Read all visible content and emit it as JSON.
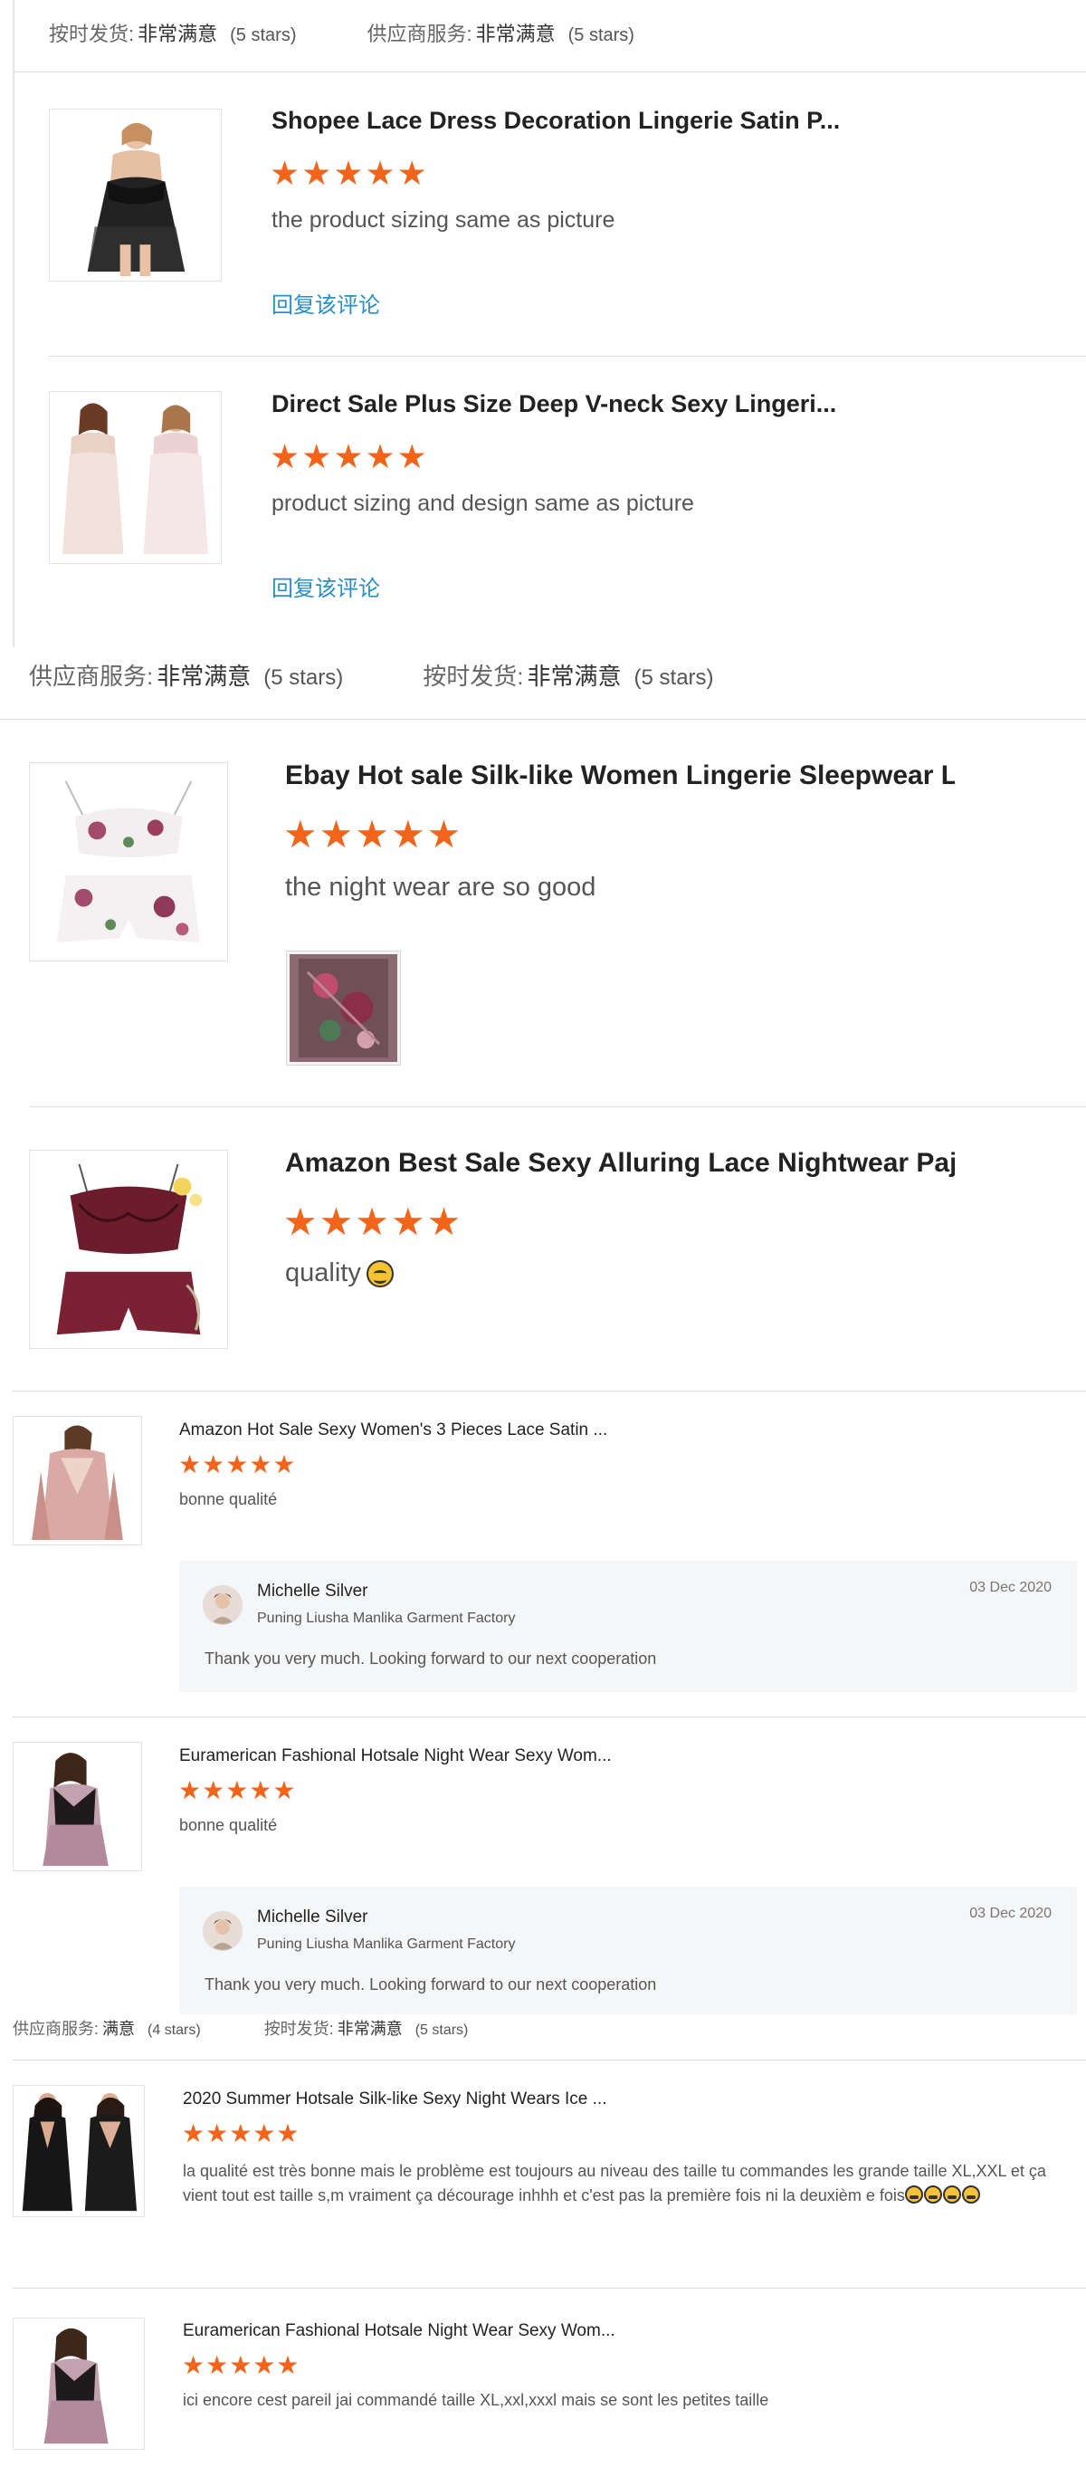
{
  "fragment_a": {
    "rating": {
      "delivery_label": "按时发货:",
      "delivery_value": "非常满意",
      "delivery_stars": "(5 stars)",
      "service_label": "供应商服务:",
      "service_value": "非常满意",
      "service_stars": "(5 stars)"
    },
    "reviews": [
      {
        "title": "Shopee Lace Dress Decoration Lingerie Satin P...",
        "stars": "★★★★★",
        "comment": "the product sizing same as picture",
        "reply_link": "回复该评论"
      },
      {
        "title": "Direct Sale Plus Size Deep V-neck Sexy Lingeri...",
        "stars": "★★★★★",
        "comment": "product sizing and design same as picture",
        "reply_link": "回复该评论"
      }
    ]
  },
  "fragment_b": {
    "rating": {
      "service_label": "供应商服务:",
      "service_value": "非常满意",
      "service_stars": "(5 stars)",
      "delivery_label": "按时发货:",
      "delivery_value": "非常满意",
      "delivery_stars": "(5 stars)"
    },
    "reviews": [
      {
        "title": "Ebay Hot sale Silk-like Women Lingerie Sleepwear La...",
        "stars": "★★★★★",
        "comment": "the night wear are so good"
      },
      {
        "title": "Amazon Best Sale Sexy Alluring Lace Nightwear Paja...",
        "stars": "★★★★★",
        "comment": "quality"
      }
    ]
  },
  "fragment_c": {
    "reviews": [
      {
        "title": "Amazon Hot Sale Sexy Women's 3 Pieces Lace Satin ...",
        "stars": "★★★★★",
        "comment": "bonne qualité",
        "reply": {
          "name": "Michelle Silver",
          "company": "Puning Liusha Manlika Garment Factory",
          "date": "03 Dec 2020",
          "text": "Thank you very much. Looking forward to our next cooperation"
        }
      },
      {
        "title": "Euramerican Fashional Hotsale Night Wear Sexy Wom...",
        "stars": "★★★★★",
        "comment": "bonne qualité",
        "reply": {
          "name": "Michelle Silver",
          "company": "Puning Liusha Manlika Garment Factory",
          "date": "03 Dec 2020",
          "text": "Thank you very much. Looking forward to our next cooperation"
        }
      }
    ]
  },
  "fragment_d": {
    "rating": {
      "service_label": "供应商服务:",
      "service_value": "满意",
      "service_stars": "(4 stars)",
      "delivery_label": "按时发货:",
      "delivery_value": "非常满意",
      "delivery_stars": "(5 stars)"
    },
    "reviews": [
      {
        "title": "2020 Summer Hotsale Silk-like Sexy Night Wears Ice ...",
        "stars": "★★★★★",
        "comment": "la qualité est très bonne mais le problème est toujours au niveau des taille tu commandes les grande taille XL,XXL et ça vient tout est taille s,m vraiment ça décourage inhhh et c'est pas la première fois ni la deuxièm e fois"
      },
      {
        "title": "Euramerican Fashional Hotsale Night Wear Sexy Wom...",
        "stars": "★★★★★",
        "comment": "ici encore cest pareil jai commandé taille XL,xxl,xxxl mais se sont les petites taille"
      }
    ]
  },
  "colors": {
    "star": "#f26419",
    "link": "#2a8ec8",
    "divider": "#dcdcdc",
    "reply_bg": "#f5f6f7"
  }
}
